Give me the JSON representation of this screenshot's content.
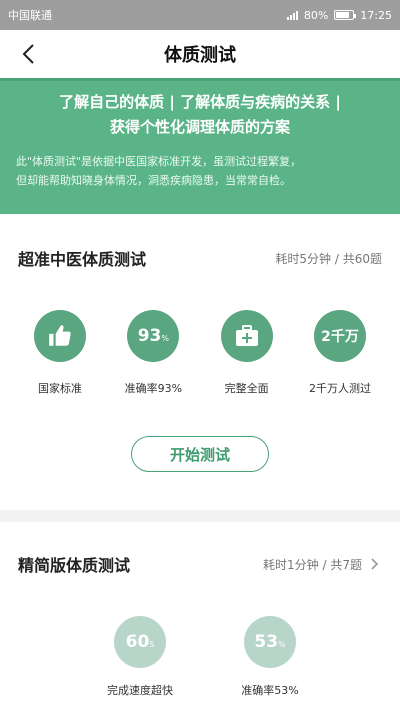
{
  "status_bar": {
    "carrier": "中国联通",
    "battery": "80%",
    "battery_level": 0.8,
    "time": "17:25",
    "icons": [
      "signal-icon",
      "battery-icon"
    ]
  },
  "header": {
    "title": "体质测试",
    "back_icon": "back-arrow-icon"
  },
  "banner": {
    "headline_line1": "了解自己的体质 | 了解体质与疾病的关系 |",
    "headline_line2": "获得个性化调理体质的方案",
    "description_line1": "此\"体质测试\"是依据中医国家标准开发，虽测试过程繁复，",
    "description_line2": "但却能帮助知晓身体情况，洞悉疾病隐患，当常常自检。",
    "color": "#5bb488"
  },
  "section1": {
    "title": "超准中医体质测试",
    "meta": "耗时5分钟 / 共60题",
    "features": [
      {
        "icon": "thumbs-up-icon",
        "label": "国家标准"
      },
      {
        "value": "93",
        "unit": "%",
        "label": "准确率93%"
      },
      {
        "icon": "medical-kit-icon",
        "label": "完整全面"
      },
      {
        "value": "2千万",
        "label": "2千万人测过"
      }
    ],
    "start_button": "开始测试",
    "accent_color": "#4aa276"
  },
  "section2": {
    "title": "精简版体质测试",
    "meta": "耗时1分钟 / 共7题",
    "chevron_icon": "chevron-right-icon",
    "features": [
      {
        "value": "60",
        "unit": "S",
        "label": "完成速度超快"
      },
      {
        "value": "53",
        "unit": "%",
        "label": "准确率53%"
      }
    ]
  }
}
